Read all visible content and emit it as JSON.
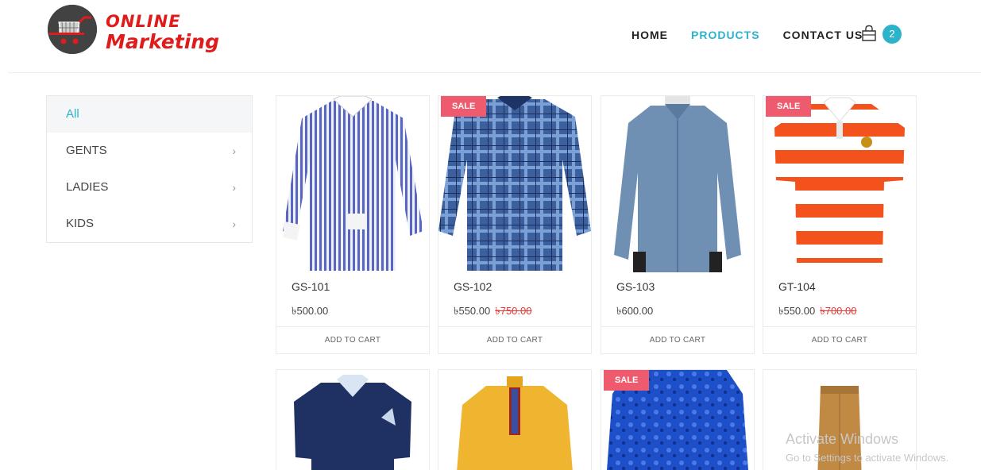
{
  "logo": {
    "line1": "ONLINE",
    "line2": "Marketing"
  },
  "nav": {
    "items": [
      "HOME",
      "PRODUCTS",
      "CONTACT US"
    ],
    "active": "PRODUCTS",
    "cart_count": "2"
  },
  "colors": {
    "accent": "#2bb3c9",
    "sale_badge": "#ef5b6e",
    "old_price": "#e53935",
    "logo_red": "#e01b1b"
  },
  "sidebar": {
    "categories": [
      {
        "label": "All",
        "active": true
      },
      {
        "label": "GENTS",
        "chevron": "›"
      },
      {
        "label": "LADIES",
        "chevron": "›"
      },
      {
        "label": "KIDS",
        "chevron": "›"
      }
    ]
  },
  "sale_label": "SALE",
  "add_to_cart": "ADD TO CART",
  "products": [
    {
      "code": "GS-101",
      "price": "৳500.00",
      "old_price": ""
    },
    {
      "code": "GS-102",
      "price": "৳550.00",
      "old_price": "৳750.00",
      "sale": true
    },
    {
      "code": "GS-103",
      "price": "৳600.00",
      "old_price": ""
    },
    {
      "code": "GT-104",
      "price": "৳550.00",
      "old_price": "৳700.00",
      "sale": true
    }
  ],
  "products_row2": [
    {
      "sale": false
    },
    {
      "sale": false
    },
    {
      "sale": true
    },
    {
      "sale": false
    }
  ],
  "watermark": {
    "line1": "Activate Windows",
    "line2": "Go to Settings to activate Windows."
  }
}
